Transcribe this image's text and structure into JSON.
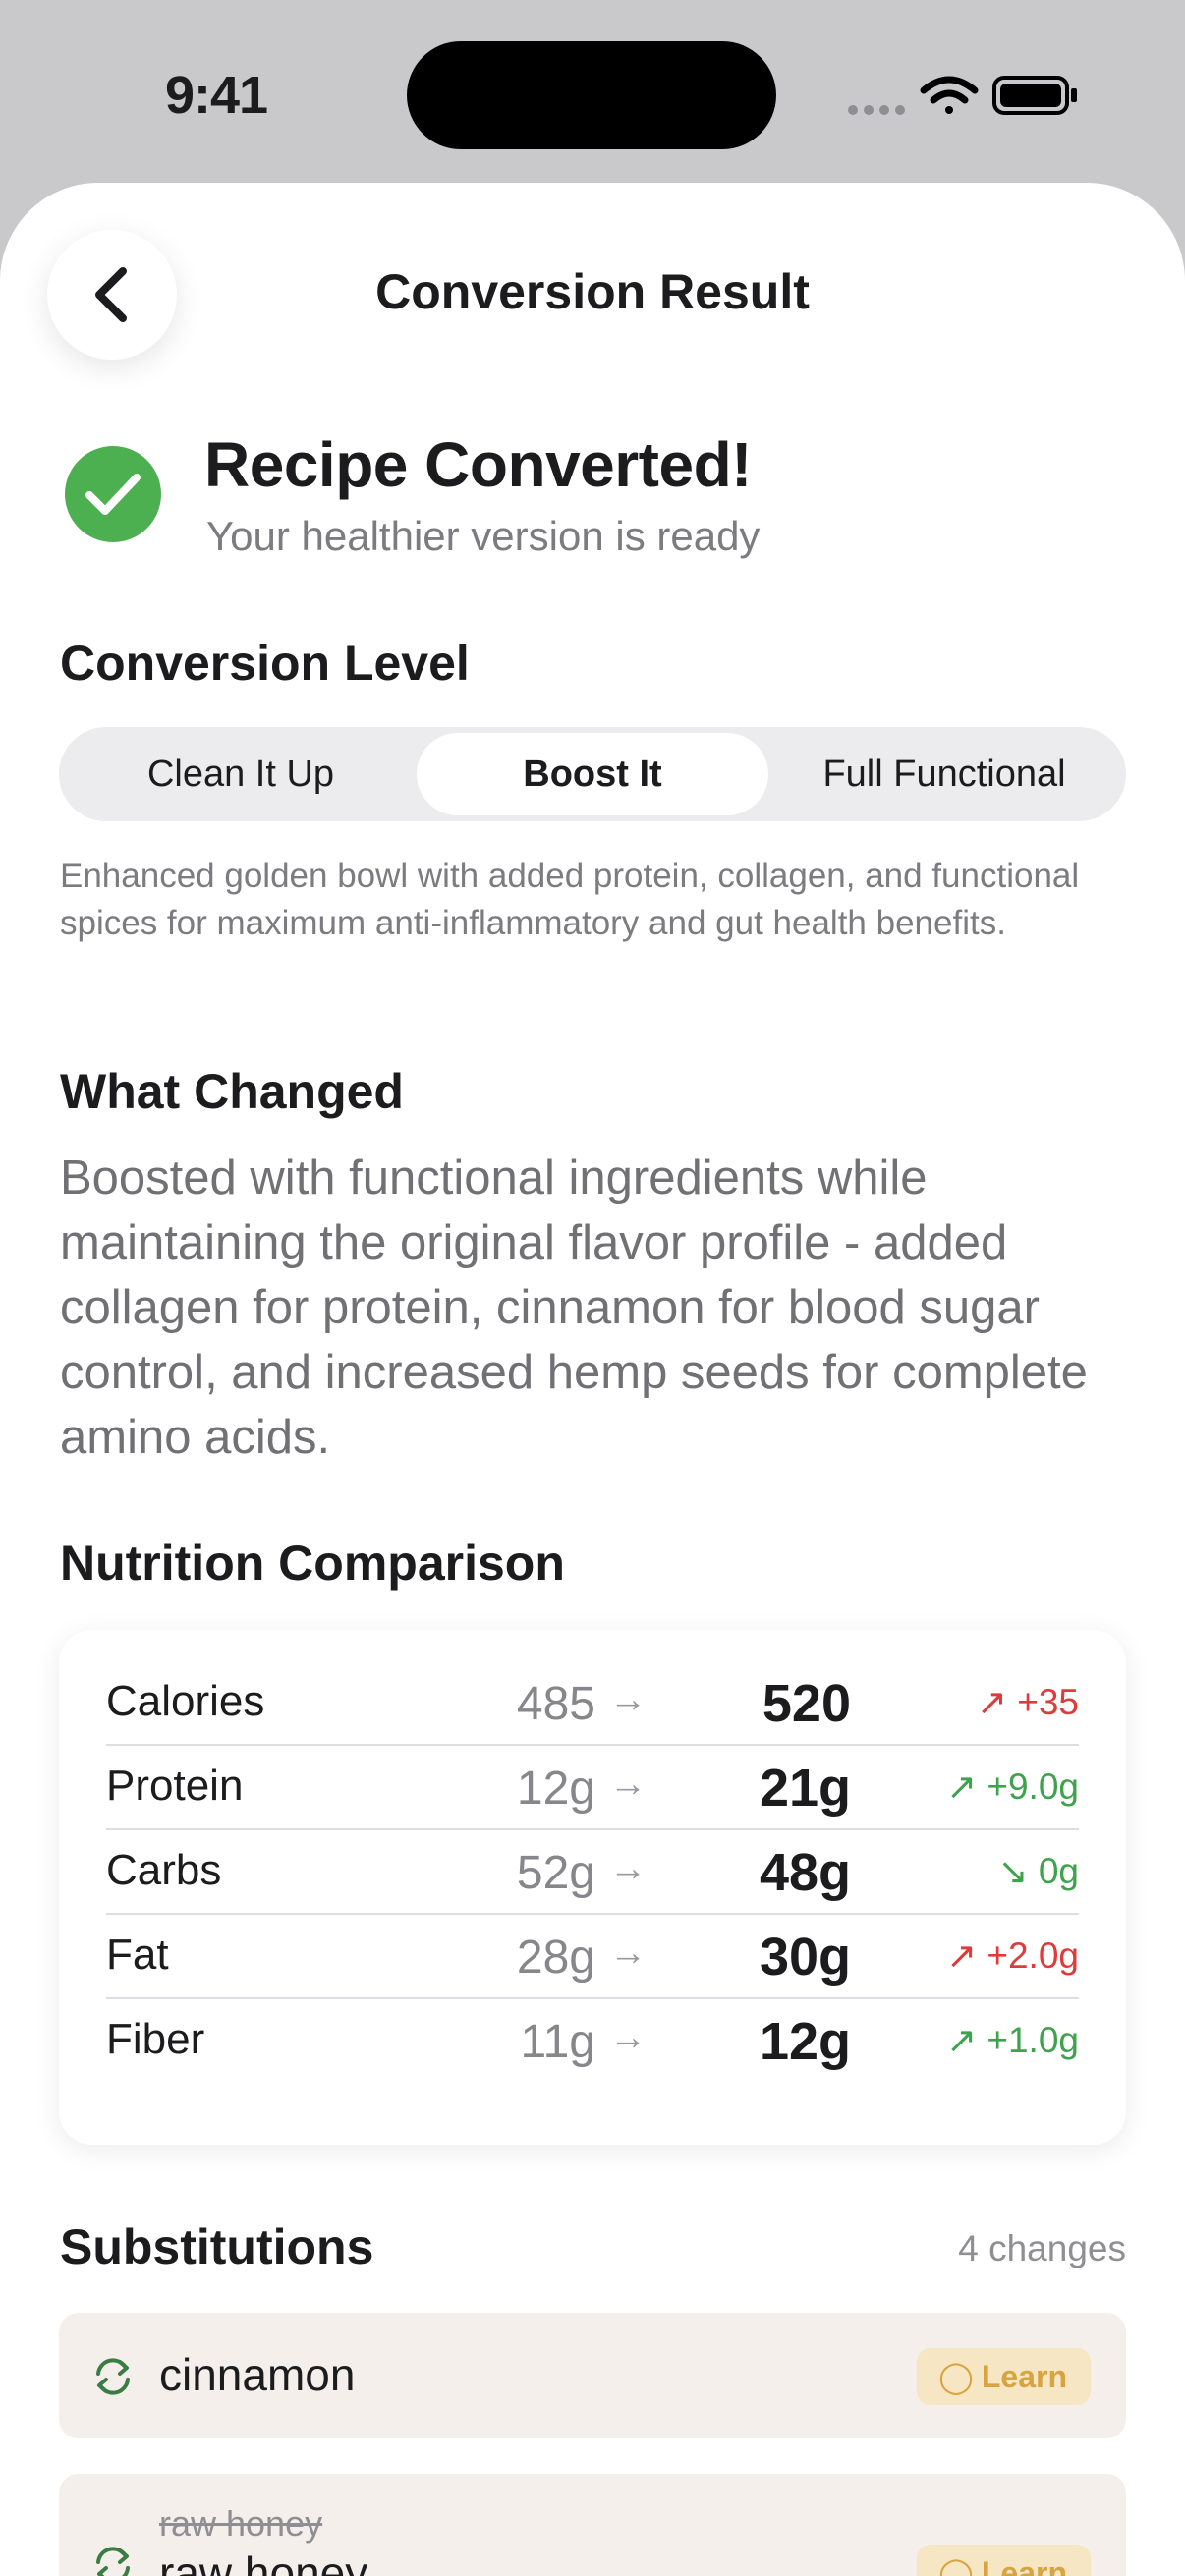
{
  "status_bar": {
    "time": "9:41"
  },
  "nav": {
    "title": "Conversion Result"
  },
  "success": {
    "title": "Recipe Converted!",
    "subtitle": "Your healthier version is ready"
  },
  "conversion_level": {
    "heading": "Conversion Level",
    "options": [
      "Clean It Up",
      "Boost It",
      "Full Functional"
    ],
    "selected": "Boost It",
    "description": "Enhanced golden bowl with added protein, collagen, and functional spices for maximum anti-inflammatory and gut health benefits."
  },
  "what_changed": {
    "heading": "What Changed",
    "text": "Boosted with functional ingredients while maintaining the original flavor profile - added collagen for protein, cinnamon for blood sugar control, and increased hemp seeds for complete amino acids."
  },
  "nutrition": {
    "heading": "Nutrition Comparison",
    "rows": [
      {
        "label": "Calories",
        "old": "485",
        "new": "520",
        "delta": "+35",
        "direction": "up",
        "color": "#e03a3a"
      },
      {
        "label": "Protein",
        "old": "12g",
        "new": "21g",
        "delta": "+9.0g",
        "direction": "up",
        "color": "#3fa34d"
      },
      {
        "label": "Carbs",
        "old": "52g",
        "new": "48g",
        "delta": "0g",
        "direction": "down",
        "color": "#3fa34d"
      },
      {
        "label": "Fat",
        "old": "28g",
        "new": "30g",
        "delta": "+2.0g",
        "direction": "up",
        "color": "#e03a3a"
      },
      {
        "label": "Fiber",
        "old": "11g",
        "new": "12g",
        "delta": "+1.0g",
        "direction": "up",
        "color": "#3fa34d"
      }
    ]
  },
  "substitutions": {
    "heading": "Substitutions",
    "count": "4 changes",
    "items": [
      {
        "name": "cinnamon",
        "learn_label": "Learn"
      },
      {
        "original": "raw honey",
        "name": "raw honey",
        "learn_label": "Learn"
      }
    ]
  },
  "colors": {
    "success_green": "#4caf50",
    "learn_accent": "#d6a440",
    "card_bg": "#f4efea"
  }
}
